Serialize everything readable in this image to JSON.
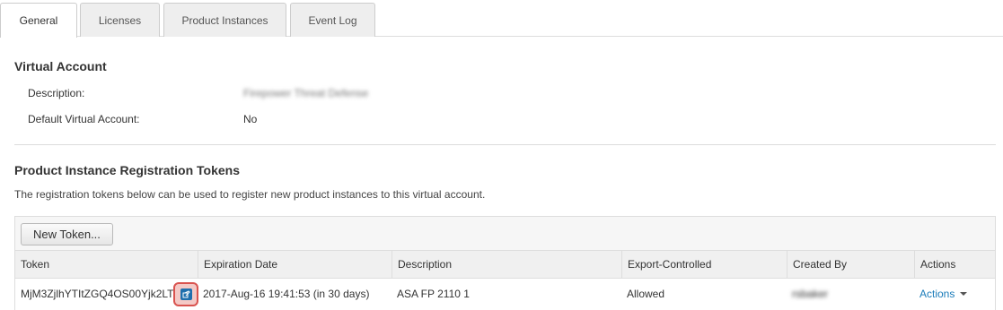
{
  "tabs": [
    {
      "label": "General",
      "active": true
    },
    {
      "label": "Licenses",
      "active": false
    },
    {
      "label": "Product Instances",
      "active": false
    },
    {
      "label": "Event Log",
      "active": false
    }
  ],
  "virtual_account": {
    "title": "Virtual Account",
    "description_label": "Description:",
    "description_value": "Firepower Threat Defense",
    "default_label": "Default Virtual Account:",
    "default_value": "No"
  },
  "tokens": {
    "title": "Product Instance Registration Tokens",
    "description": "The registration tokens below can be used to register new product instances to this virtual account.",
    "new_token_label": "New Token...",
    "columns": [
      "Token",
      "Expiration Date",
      "Description",
      "Export-Controlled",
      "Created By",
      "Actions"
    ],
    "rows": [
      {
        "token": "MjM3ZjlhYTItZGQ4OS00Yjk2LT",
        "expiration": "2017-Aug-16 19:41:53 (in 30 days)",
        "description": "ASA FP 2110 1",
        "export_controlled": "Allowed",
        "created_by": "rsbaker",
        "actions_label": "Actions"
      }
    ]
  },
  "icons": {
    "copy": "copy-to-clipboard-icon",
    "caret": "caret-down-icon"
  },
  "colors": {
    "link": "#1a7bb9",
    "highlight_border": "#d9534f",
    "copy_icon": "#1f6fad"
  }
}
